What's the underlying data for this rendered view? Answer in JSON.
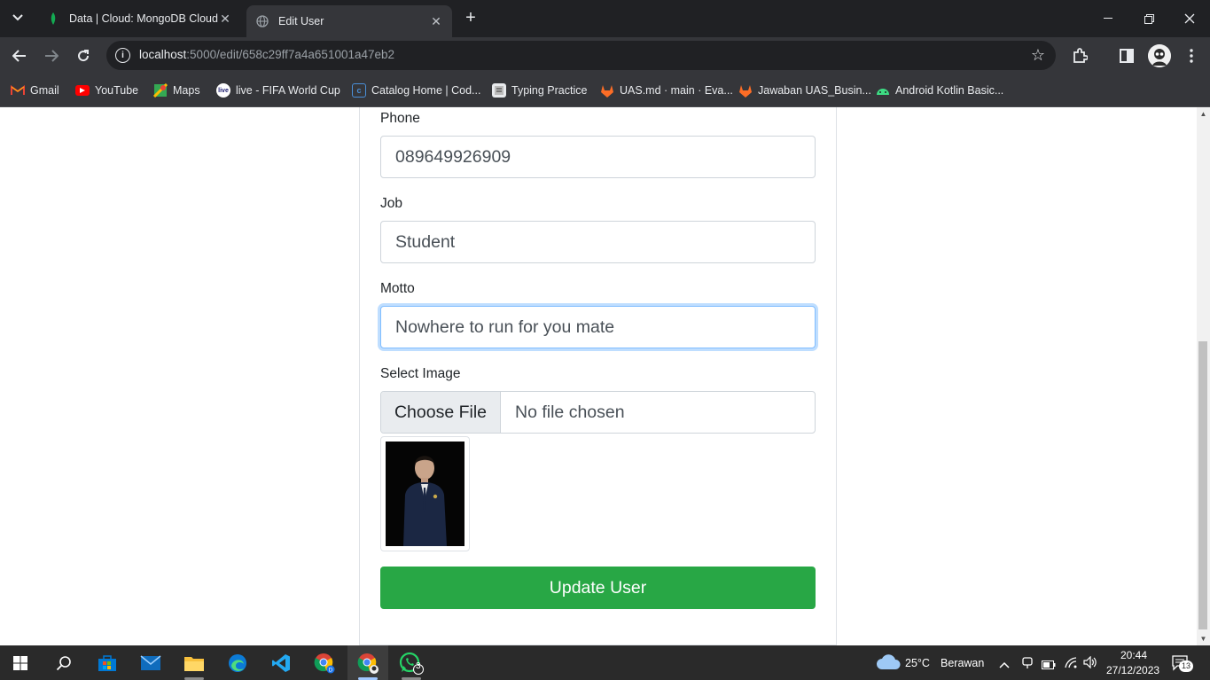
{
  "browser": {
    "tabs": [
      {
        "label": "Data | Cloud: MongoDB Cloud",
        "icon": "mongodb-leaf-icon",
        "active": false
      },
      {
        "label": "Edit User",
        "icon": "globe-icon",
        "active": true
      }
    ],
    "url_host": "localhost",
    "url_path": ":5000/edit/658c29ff7a4a651001a47eb2",
    "bookmarks": [
      {
        "label": "Gmail",
        "icon": "gmail-icon"
      },
      {
        "label": "YouTube",
        "icon": "youtube-icon"
      },
      {
        "label": "Maps",
        "icon": "maps-icon"
      },
      {
        "label": "live - FIFA World Cup",
        "icon": "live-icon"
      },
      {
        "label": "Catalog Home | Cod...",
        "icon": "catalog-icon"
      },
      {
        "label": "Typing Practice",
        "icon": "typing-icon"
      },
      {
        "label": "UAS.md · main · Eva...",
        "icon": "gitlab-icon"
      },
      {
        "label": "Jawaban UAS_Busin...",
        "icon": "gitlab-icon"
      },
      {
        "label": "Android Kotlin Basic...",
        "icon": "android-icon"
      }
    ]
  },
  "form": {
    "phone_label": "Phone",
    "phone_value": "089649926909",
    "job_label": "Job",
    "job_value": "Student",
    "motto_label": "Motto",
    "motto_value": "Nowhere to run for you mate",
    "image_label": "Select Image",
    "choose_file_label": "Choose File",
    "no_file_text": "No file chosen",
    "submit_label": "Update User"
  },
  "taskbar": {
    "weather_temp": "25°C",
    "weather_text": "Berawan",
    "time": "20:44",
    "date": "27/12/2023",
    "notification_count": "13",
    "whatsapp_badge": "3"
  },
  "colors": {
    "submit_green": "#28a745",
    "focus_blue": "#80bdff",
    "tabbar": "#202124",
    "toolbar": "#35363a"
  }
}
